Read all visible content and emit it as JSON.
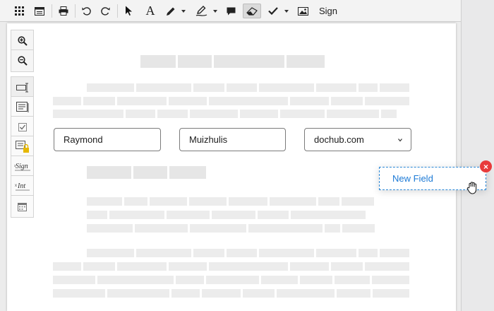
{
  "toolbar": {
    "items": [
      {
        "name": "grid-icon"
      },
      {
        "name": "pages-icon"
      },
      {
        "name": "print-icon"
      },
      {
        "name": "undo-icon"
      },
      {
        "name": "redo-icon"
      },
      {
        "name": "pointer-icon"
      },
      {
        "name": "text-icon"
      },
      {
        "name": "pencil-icon"
      },
      {
        "name": "highlighter-icon"
      },
      {
        "name": "comment-icon"
      },
      {
        "name": "eraser-icon",
        "active": true
      },
      {
        "name": "checkmark-icon"
      },
      {
        "name": "image-icon"
      }
    ],
    "sign_label": "Sign"
  },
  "sidebar_tools": [
    {
      "name": "zoom-in-icon"
    },
    {
      "name": "zoom-out-icon"
    },
    {
      "name": "text-field-icon"
    },
    {
      "name": "text-area-icon"
    },
    {
      "name": "checkbox-icon"
    },
    {
      "name": "locked-field-icon"
    },
    {
      "name": "signature-field-icon"
    },
    {
      "name": "initials-field-icon"
    },
    {
      "name": "date-field-icon"
    }
  ],
  "fields": {
    "first_name": "Raymond",
    "last_name": "Muizhulis",
    "domain_select": "dochub.com"
  },
  "new_field": {
    "label": "New Field",
    "close_symbol": "×"
  },
  "colors": {
    "accent": "#1c7ad6",
    "close_badge": "#e83b3b"
  }
}
